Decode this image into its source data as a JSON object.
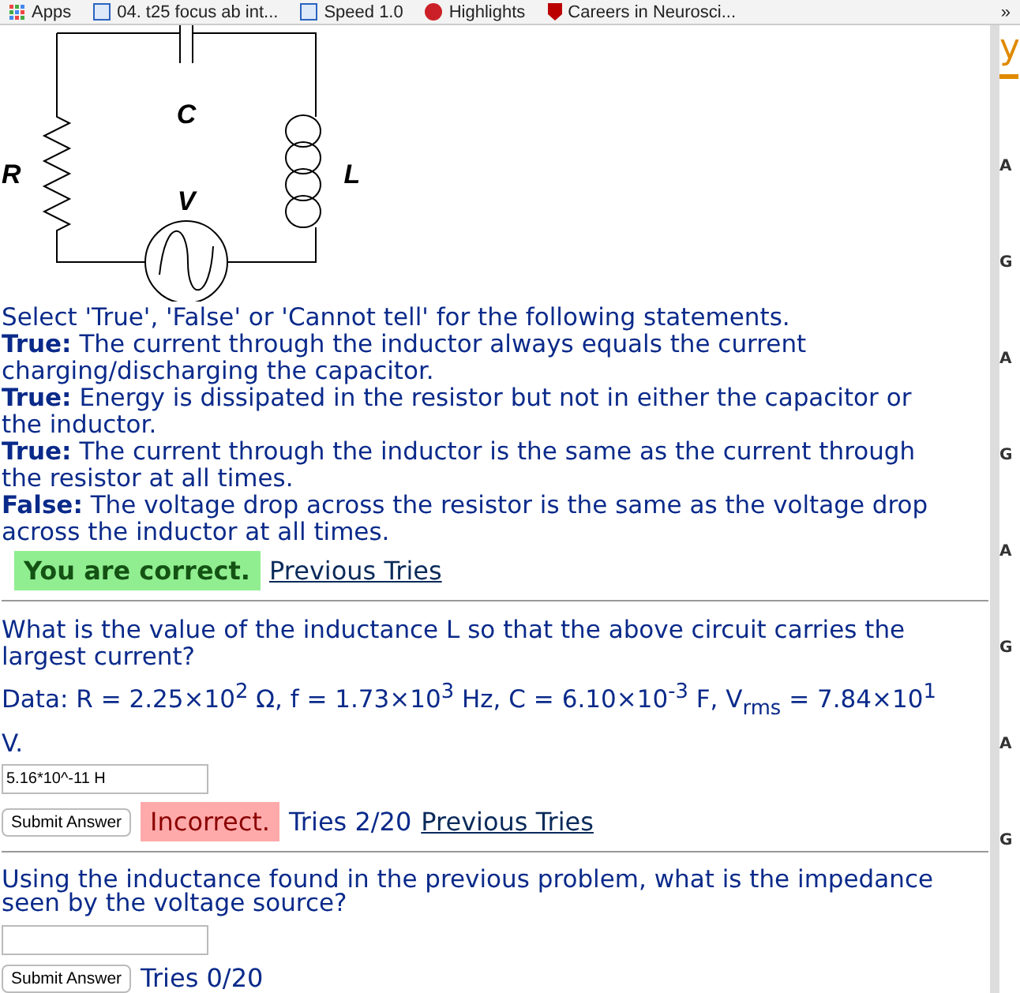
{
  "bookmarks": {
    "items": [
      {
        "label": "Apps",
        "kind": "apps"
      },
      {
        "label": "04. t25 focus ab int...",
        "kind": "page"
      },
      {
        "label": "Speed 1.0",
        "kind": "page"
      },
      {
        "label": "Highlights",
        "kind": "pin"
      },
      {
        "label": "Careers in Neurosci...",
        "kind": "shield"
      }
    ],
    "overflow": "»"
  },
  "circuit": {
    "labels": [
      {
        "text": "R",
        "kind": "resistor"
      },
      {
        "text": "C",
        "kind": "capacitor"
      },
      {
        "text": "L",
        "kind": "inductor"
      },
      {
        "text": "V",
        "kind": "source"
      }
    ]
  },
  "problems": [
    {
      "prompt": "Select 'True', 'False' or 'Cannot tell' for the following statements.",
      "statements": [
        "**True:** The current through the inductor always equals the current charging/discharging the capacitor.",
        "**True:** Energy is dissipated in the resistor but not in either the capacitor or the inductor.",
        "**True:** The current through the inductor is the same as the current through the resistor at all times.",
        "**False:** The voltage drop across the resistor is the same as the voltage drop across the inductor at all times."
      ],
      "feedback": {
        "kind": "correct",
        "text": "You are correct."
      },
      "link": "Previous Tries"
    },
    {
      "prompt": "What is the value of the inductance L so that the above circuit carries the largest current?",
      "data": "Data: R = 2.25×10$^{2}$ Ω, f = 1.73×10$^{3}$ Hz, C = 6.10×10$^{-3}$ F, V$_{rms}$ = 7.84×10$^{1}$ V.",
      "answer": "5.16*10^-11 H",
      "button": "Submit Answer",
      "feedback": {
        "kind": "incorrect",
        "text": "Incorrect."
      },
      "tries": "Tries 2/20",
      "link": "Previous Tries"
    },
    {
      "prompt": "Using the inductance found in the previous problem, what is the impedance seen by the voltage source?",
      "button": "Submit Answer",
      "tries": "Tries 0/20"
    }
  ],
  "side_panel": {
    "heading": "y",
    "letters": [
      "A",
      "G",
      "A",
      "G",
      "A",
      "G",
      "A",
      "G"
    ]
  }
}
